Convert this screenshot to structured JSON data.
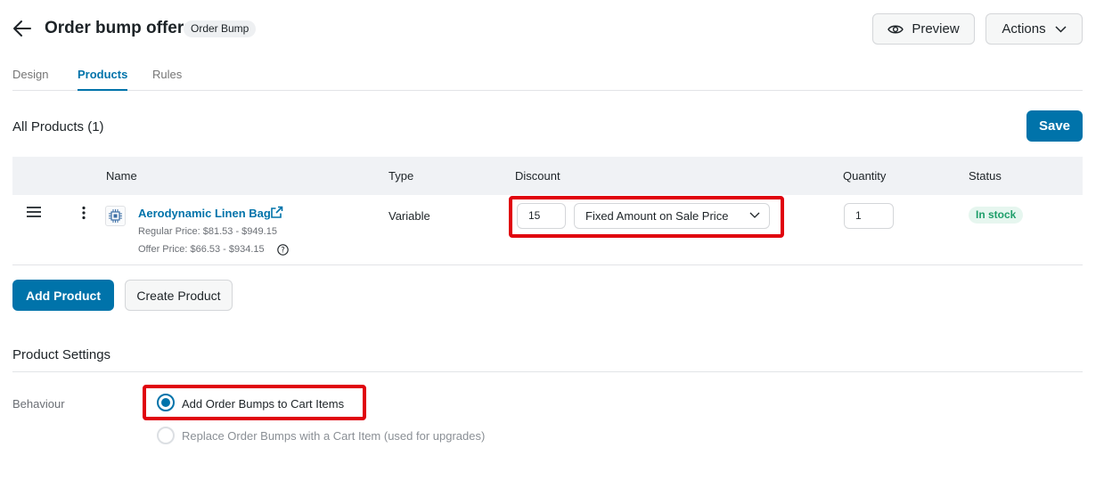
{
  "header": {
    "title": "Order bump offer",
    "badge": "Order Bump",
    "preview_label": "Preview",
    "actions_label": "Actions"
  },
  "tabs": [
    {
      "label": "Design",
      "active": false
    },
    {
      "label": "Products",
      "active": true
    },
    {
      "label": "Rules",
      "active": false
    }
  ],
  "products": {
    "section_title": "All Products (1)",
    "save_label": "Save",
    "columns": [
      "Name",
      "Type",
      "Discount",
      "Quantity",
      "Status"
    ],
    "rows": [
      {
        "name": "Aerodynamic Linen Bag",
        "regular_price": "Regular Price: $81.53 - $949.15",
        "offer_price": "Offer Price: $66.53 - $934.15",
        "type": "Variable",
        "discount_value": "15",
        "discount_type": "Fixed Amount on Sale Price",
        "quantity": "1",
        "status": "In stock"
      }
    ],
    "add_product_label": "Add Product",
    "create_product_label": "Create Product"
  },
  "settings": {
    "title": "Product Settings",
    "behaviour_label": "Behaviour",
    "options": [
      {
        "label": "Add Order Bumps to Cart Items",
        "selected": true
      },
      {
        "label": "Replace Order Bumps with a Cart Item (used for upgrades)",
        "selected": false
      }
    ]
  },
  "colors": {
    "accent": "#0073aa",
    "highlight": "#e0010d",
    "stock_badge_bg": "#e6f6ef",
    "stock_badge_text": "#1e9e6a"
  }
}
